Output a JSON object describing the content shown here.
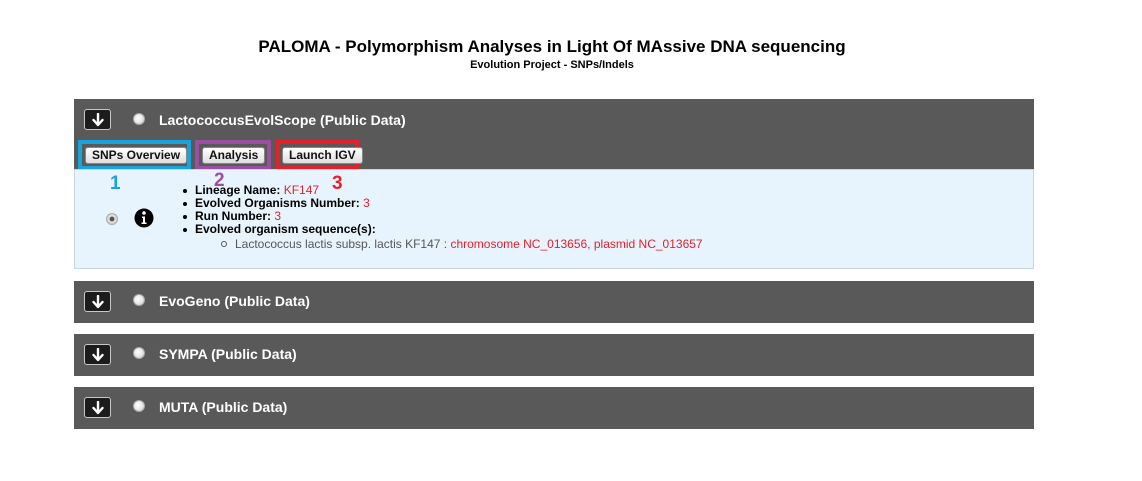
{
  "header": {
    "title": "PALOMA - Polymorphism Analyses in Light Of MAssive DNA sequencing",
    "subtitle": "Evolution Project - SNPs/Indels"
  },
  "panels": [
    {
      "title": "LactococcusEvolScope (Public Data)"
    },
    {
      "title": "EvoGeno (Public Data)"
    },
    {
      "title": "SYMPA (Public Data)"
    },
    {
      "title": "MUTA (Public Data)"
    }
  ],
  "tabs": [
    {
      "label": "SNPs Overview",
      "number": "1",
      "color": "#19a3dc"
    },
    {
      "label": "Analysis",
      "number": "2",
      "color": "#9a4fa3"
    },
    {
      "label": "Launch IGV",
      "number": "3",
      "color": "#e4202b"
    }
  ],
  "details": {
    "lineage_label": "Lineage Name:",
    "lineage_value": "KF147",
    "organisms_label": "Evolved Organisms Number:",
    "organisms_value": "3",
    "run_label": "Run Number:",
    "run_value": "3",
    "sequences_label": "Evolved organism sequence(s):",
    "sequence_name": "Lactococcus lactis subsp. lactis KF147 :",
    "sequence_links": "chromosome NC_013656, plasmid NC_013657"
  },
  "colors": {
    "panel_bg": "#595959",
    "link_red": "#e4202b"
  }
}
